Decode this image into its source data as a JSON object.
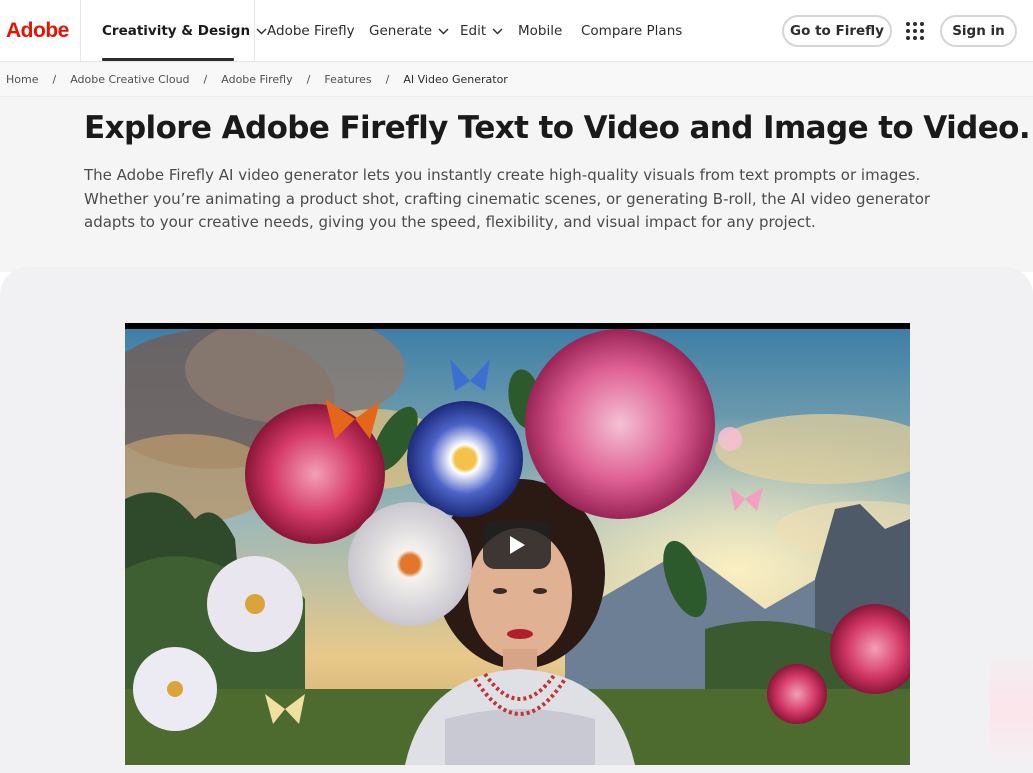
{
  "nav": {
    "logo_text": "Adobe",
    "brand_color": "#eb1000",
    "primary_menu": "Creativity & Design",
    "items": [
      "Adobe Firefly",
      "Generate",
      "Edit",
      "Mobile",
      "Compare Plans"
    ],
    "cta_label": "Go to Firefly",
    "signin_label": "Sign in",
    "apps_icon": "app-grid-icon"
  },
  "breadcrumb": [
    "Home",
    "Adobe Creative Cloud",
    "Adobe Firefly",
    "Features",
    "AI Video Generator"
  ],
  "intro": {
    "title": "Explore Adobe Firefly Text to Video and Image to Video.",
    "description": "The Adobe Firefly AI video generator lets you instantly create high-quality visuals from text prompts or images. Whether you’re animating a product shot, crafting cinematic scenes, or generating B-roll, the AI video generator adapts to your creative needs, giving you the speed, flexibility, and visual impact for any project."
  },
  "video": {
    "play_icon": "play-icon"
  }
}
